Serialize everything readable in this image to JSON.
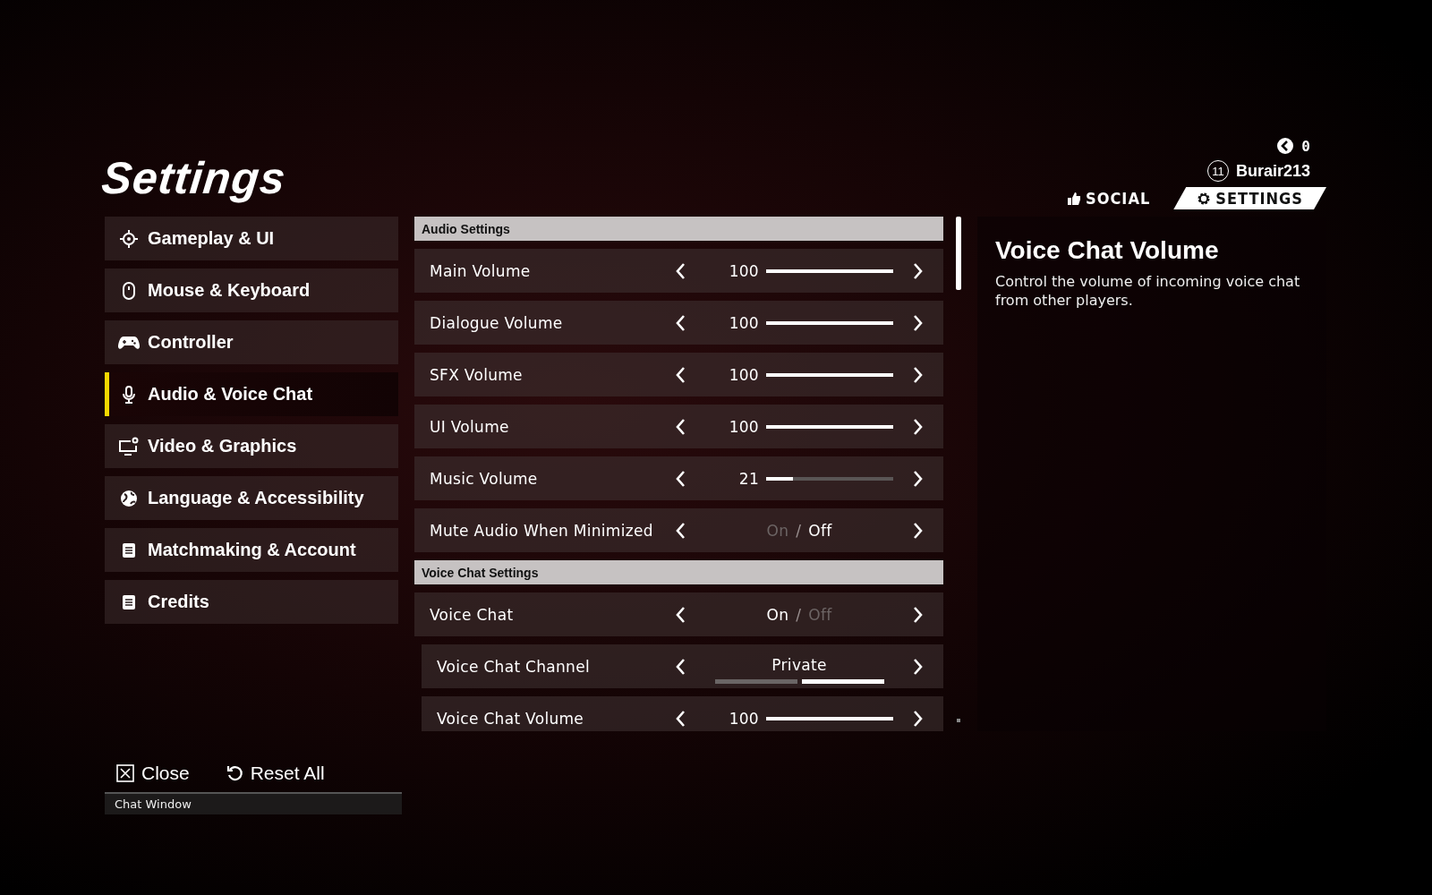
{
  "title": "Settings",
  "profile": {
    "currency": "0",
    "level": "11",
    "username": "Burair213"
  },
  "nav_tabs": [
    {
      "label": "SOCIAL",
      "selected": false
    },
    {
      "label": "SETTINGS",
      "selected": true
    }
  ],
  "sidebar": {
    "items": [
      {
        "label": "Gameplay & UI",
        "selected": false
      },
      {
        "label": "Mouse & Keyboard",
        "selected": false
      },
      {
        "label": "Controller",
        "selected": false
      },
      {
        "label": "Audio & Voice Chat",
        "selected": true
      },
      {
        "label": "Video & Graphics",
        "selected": false
      },
      {
        "label": "Language & Accessibility",
        "selected": false
      },
      {
        "label": "Matchmaking & Account",
        "selected": false
      },
      {
        "label": "Credits",
        "selected": false
      }
    ]
  },
  "sections": [
    {
      "title": "Audio Settings",
      "rows": [
        {
          "kind": "slider",
          "label": "Main Volume",
          "value": "100",
          "level": 1
        },
        {
          "kind": "slider",
          "label": "Dialogue Volume",
          "value": "100",
          "level": 1
        },
        {
          "kind": "slider",
          "label": "SFX Volume",
          "value": "100",
          "level": 1
        },
        {
          "kind": "slider",
          "label": "UI Volume",
          "value": "100",
          "level": 1
        },
        {
          "kind": "slider",
          "label": "Music Volume",
          "value": "21",
          "level": 0.21
        },
        {
          "kind": "toggle",
          "label": "Mute Audio When Minimized",
          "separator": "/",
          "options": [
            {
              "label": "On",
              "selected": false
            },
            {
              "label": "Off",
              "selected": true
            }
          ]
        }
      ]
    },
    {
      "title": "Voice Chat Settings",
      "rows": [
        {
          "kind": "toggle",
          "label": "Voice Chat",
          "separator": "/",
          "options": [
            {
              "label": "On",
              "selected": true
            },
            {
              "label": "Off",
              "selected": false
            }
          ],
          "children": [
            {
              "kind": "choice",
              "label": "Voice Chat Channel",
              "value": "Private",
              "segments": [
                {
                  "selected": false
                },
                {
                  "selected": true
                }
              ]
            },
            {
              "kind": "slider",
              "label": "Voice Chat Volume",
              "value": "100",
              "level": 1
            }
          ]
        }
      ]
    }
  ],
  "description": {
    "title": "Voice Chat Volume",
    "text": "Control the volume of incoming voice chat from other players."
  },
  "footer": {
    "buttons": [
      {
        "label": "Close"
      },
      {
        "label": "Reset All"
      }
    ],
    "chat_window": "Chat Window"
  }
}
